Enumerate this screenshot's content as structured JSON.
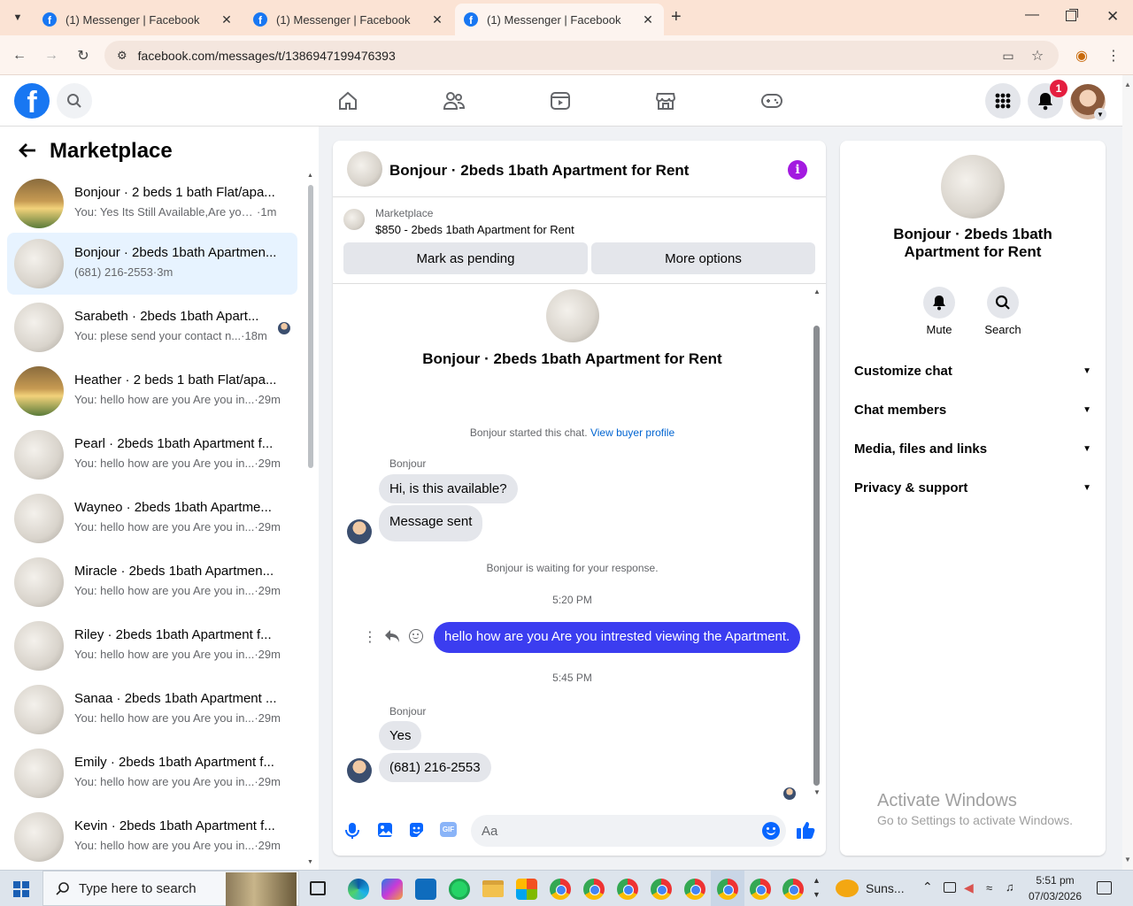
{
  "browser": {
    "tabs": [
      {
        "title": "(1) Messenger | Facebook",
        "active": false
      },
      {
        "title": "(1) Messenger | Facebook",
        "active": false
      },
      {
        "title": "(1) Messenger | Facebook",
        "active": true
      }
    ],
    "url": "facebook.com/messages/t/1386947199476393"
  },
  "fb": {
    "logo": "f",
    "notif_count": "1"
  },
  "left": {
    "title": "Marketplace",
    "conversations": [
      {
        "name": "Bonjour · 2 beds 1 bath Flat/apa...",
        "preview": "You: Yes Its Still Available,Are you i...",
        "time": "1m"
      },
      {
        "name": "Bonjour · 2beds 1bath Apartmen...",
        "preview": "(681) 216-2553",
        "time": "3m"
      },
      {
        "name": "Sarabeth · 2beds 1bath Apart...",
        "preview": "You: plese send your contact n...",
        "time": "18m"
      },
      {
        "name": "Heather · 2 beds 1 bath Flat/apa...",
        "preview": "You: hello how are you Are you in...",
        "time": "29m"
      },
      {
        "name": "Pearl · 2beds 1bath Apartment f...",
        "preview": "You: hello how are you Are you in...",
        "time": "29m"
      },
      {
        "name": "Wayneo · 2beds 1bath Apartme...",
        "preview": "You: hello how are you Are you in...",
        "time": "29m"
      },
      {
        "name": "Miracle · 2beds 1bath Apartmen...",
        "preview": "You: hello how are you Are you in...",
        "time": "29m"
      },
      {
        "name": "Riley · 2beds 1bath Apartment f...",
        "preview": "You: hello how are you Are you in...",
        "time": "29m"
      },
      {
        "name": "Sanaa · 2beds 1bath Apartment ...",
        "preview": "You: hello how are you Are you in...",
        "time": "29m"
      },
      {
        "name": "Emily · 2beds 1bath Apartment f...",
        "preview": "You: hello how are you Are you in...",
        "time": "29m"
      },
      {
        "name": "Kevin · 2beds 1bath Apartment f...",
        "preview": "You: hello how are you Are you in...",
        "time": "29m"
      }
    ]
  },
  "chat": {
    "header_title": "Bonjour · 2beds 1bath Apartment for Rent",
    "listing_label": "Marketplace",
    "listing_title": "$850 - 2beds 1bath Apartment for Rent",
    "mark_pending": "Mark as pending",
    "more_options": "More options",
    "intro_title": "Bonjour · 2beds 1bath Apartment for Rent",
    "started_text": "Bonjour started this chat.",
    "view_profile": "View buyer profile",
    "sender1": "Bonjour",
    "msg1": "Hi, is this available?",
    "msg2": "Message sent",
    "waiting": "Bonjour is waiting for your response.",
    "time1": "5:20 PM",
    "out_msg": "hello how are you Are you intrested viewing the Apartment.",
    "time2": "5:45 PM",
    "sender2": "Bonjour",
    "msg3": "Yes",
    "msg4": "(681) 216-2553",
    "composer_placeholder": "Aa"
  },
  "info": {
    "title": "Bonjour · 2beds 1bath Apartment for Rent",
    "mute": "Mute",
    "search": "Search",
    "sections": [
      "Customize chat",
      "Chat members",
      "Media, files and links",
      "Privacy & support"
    ],
    "watermark1": "Activate Windows",
    "watermark2": "Go to Settings to activate Windows."
  },
  "taskbar": {
    "search_placeholder": "Type here to search",
    "weather": "Suns...",
    "time": "5:51 pm",
    "date": "07/03/2026"
  },
  "colors": {
    "fb_blue": "#1877f2",
    "out_bubble": "#3b3df0",
    "tabbar": "#fbe3d4"
  }
}
